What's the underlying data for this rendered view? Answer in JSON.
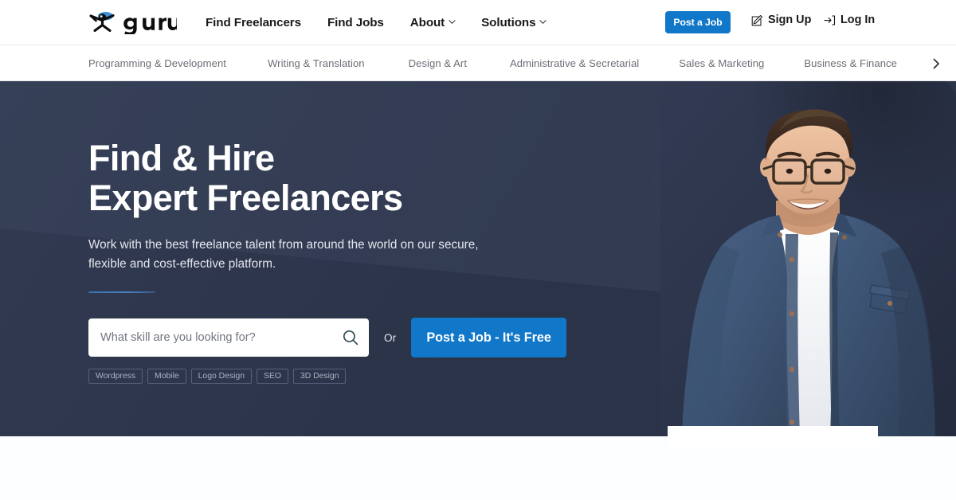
{
  "brand": {
    "name": "guru",
    "logo_icon": "guru-stickman-logo",
    "accent_blue": "#1077c9",
    "logo_swoosh_color": "#3d8fd6",
    "hero_bg": "#2b3349"
  },
  "header": {
    "nav": [
      {
        "label": "Find Freelancers",
        "has_dropdown": false,
        "name": "find-freelancers"
      },
      {
        "label": "Find Jobs",
        "has_dropdown": false,
        "name": "find-jobs"
      },
      {
        "label": "About",
        "has_dropdown": true,
        "name": "about"
      },
      {
        "label": "Solutions",
        "has_dropdown": true,
        "name": "solutions"
      }
    ],
    "post_a_job": "Post a Job",
    "sign_up": "Sign Up",
    "sign_up_icon": "edit-square-icon",
    "log_in": "Log In",
    "log_in_icon": "login-arrow-icon"
  },
  "categories": {
    "items": [
      "Programming & Development",
      "Writing & Translation",
      "Design & Art",
      "Administrative & Secretarial",
      "Sales & Marketing",
      "Business & Finance"
    ],
    "next_icon": "chevron-right-icon"
  },
  "hero": {
    "title_line1": "Find & Hire",
    "title_line2": "Expert Freelancers",
    "subtitle": "Work with the best freelance talent from around the world on our secure, flexible and cost-effective platform.",
    "search": {
      "placeholder": "What skill are you looking for?",
      "value": "",
      "icon": "search-icon"
    },
    "or_label": "Or",
    "cta_label": "Post a Job - It's Free",
    "tags": [
      "Wordpress",
      "Mobile",
      "Logo Design",
      "SEO",
      "3D Design"
    ],
    "photo_alt": "smiling-man-with-glasses-in-denim-shirt"
  }
}
